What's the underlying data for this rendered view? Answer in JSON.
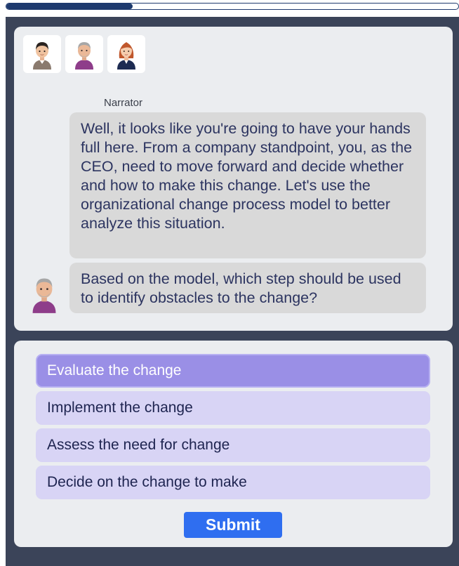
{
  "progress": {
    "fraction": 0.28,
    "color": "#1e3a6e"
  },
  "cast": {
    "avatars": [
      {
        "icon": "young-man-avatar-icon"
      },
      {
        "icon": "older-man-avatar-icon"
      },
      {
        "icon": "woman-avatar-icon"
      }
    ]
  },
  "dialogue": {
    "speaker": "Narrator",
    "messages": [
      "Well, it looks like you're going to have your hands full here. From a company standpoint, you, as the CEO, need to move forward and decide whether and how to make this change. Let's use the organizational change process model to better analyze this situation.",
      "Based on the model, which step should be used to identify obstacles to the change?"
    ],
    "speaker_avatar_icon": "older-man-avatar-icon"
  },
  "answers": {
    "options": [
      "Evaluate the change",
      "Implement the change",
      "Assess the need for change",
      "Decide on the change to make"
    ],
    "selected_index": 0,
    "submit_label": "Submit"
  },
  "colors": {
    "background": "#3b4459",
    "panel": "#ebedf0",
    "bubble": "#d9d9d9",
    "option": "#d8d4f5",
    "option_selected": "#9a8fe6",
    "submit": "#2f6ef0"
  }
}
